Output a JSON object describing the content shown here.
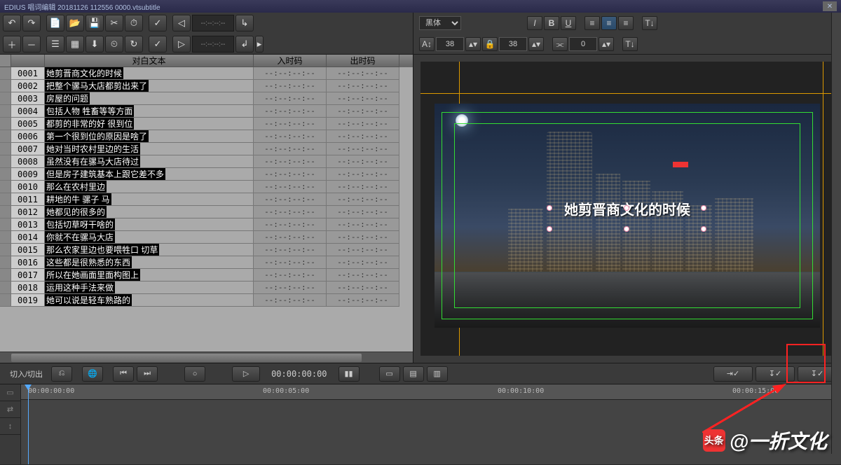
{
  "titlebar": {
    "text": "EDIUS 唱词编辑 20181126 112556 0000.vtsubtitle"
  },
  "fontControls": {
    "family": "黑体",
    "size1": "38",
    "size2": "38",
    "size3": "0"
  },
  "emptyTimecode": "--:--:--:--",
  "columns": {
    "text": "对白文本",
    "in": "入时码",
    "out": "出时码"
  },
  "subtitles": [
    {
      "num": "0001",
      "text": "她剪晋商文化的时候"
    },
    {
      "num": "0002",
      "text": "把整个骡马大店都剪出来了"
    },
    {
      "num": "0003",
      "text": "房屋的问题"
    },
    {
      "num": "0004",
      "text": "包括人物 牲畜等等方面"
    },
    {
      "num": "0005",
      "text": "都剪的非常的好 很到位"
    },
    {
      "num": "0006",
      "text": "第一个很到位的原因是啥了"
    },
    {
      "num": "0007",
      "text": "她对当时农村里边的生活"
    },
    {
      "num": "0008",
      "text": "虽然没有在骡马大店待过"
    },
    {
      "num": "0009",
      "text": "但是房子建筑基本上跟它差不多"
    },
    {
      "num": "0010",
      "text": "那么在农村里边"
    },
    {
      "num": "0011",
      "text": "耕地的牛 骡子 马"
    },
    {
      "num": "0012",
      "text": "她都见的很多的"
    },
    {
      "num": "0013",
      "text": "包括切草呀干啥的"
    },
    {
      "num": "0014",
      "text": "你就不在骡马大店"
    },
    {
      "num": "0015",
      "text": "那么农家里边也要喂牲口 切草"
    },
    {
      "num": "0016",
      "text": "这些都是很熟悉的东西"
    },
    {
      "num": "0017",
      "text": "所以在她画面里面构图上"
    },
    {
      "num": "0018",
      "text": "运用这种手法来做"
    },
    {
      "num": "0019",
      "text": "她可以说是轻车熟路的"
    }
  ],
  "preview": {
    "overlayText": "她剪晋商文化的时候"
  },
  "transport": {
    "cutLabel": "切入/切出",
    "currentTime": "00:00:00:00"
  },
  "timeline": {
    "marks": [
      "00:00:00:00",
      "00:00:05:00",
      "00:00:10:00",
      "00:00:15:00"
    ]
  },
  "watermark": {
    "brand": "头条",
    "author": "@一折文化"
  }
}
